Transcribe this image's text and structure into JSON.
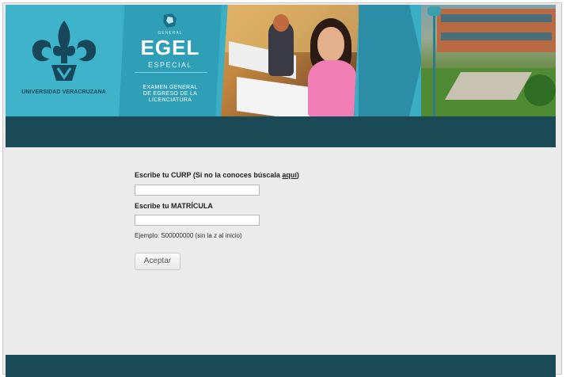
{
  "banner": {
    "university": "UNIVERSIDAD VERACRUZANA",
    "egel_general": "GENERAL",
    "egel_title": "EGEL",
    "egel_subtitle": "ESPECIAL",
    "exam_name_line1": "EXAMEN GENERAL",
    "exam_name_line2": "DE EGRESO DE LA",
    "exam_name_line3": "LICENCIATURA"
  },
  "form": {
    "curp_label_prefix": "Escribe tu CURP (Si no la conoces búscala ",
    "curp_link": "aquí",
    "curp_label_suffix": ")",
    "curp_value": "",
    "matricula_label": "Escribe tu MATRÍCULA",
    "matricula_value": "",
    "matricula_hint": "Ejemplo: S00000000 (sin la z al inicio)",
    "submit_label": "Aceptar"
  },
  "colors": {
    "banner_teal": "#3aaec5",
    "dark_band": "#1b4a57",
    "content_bg": "#ebebeb"
  }
}
